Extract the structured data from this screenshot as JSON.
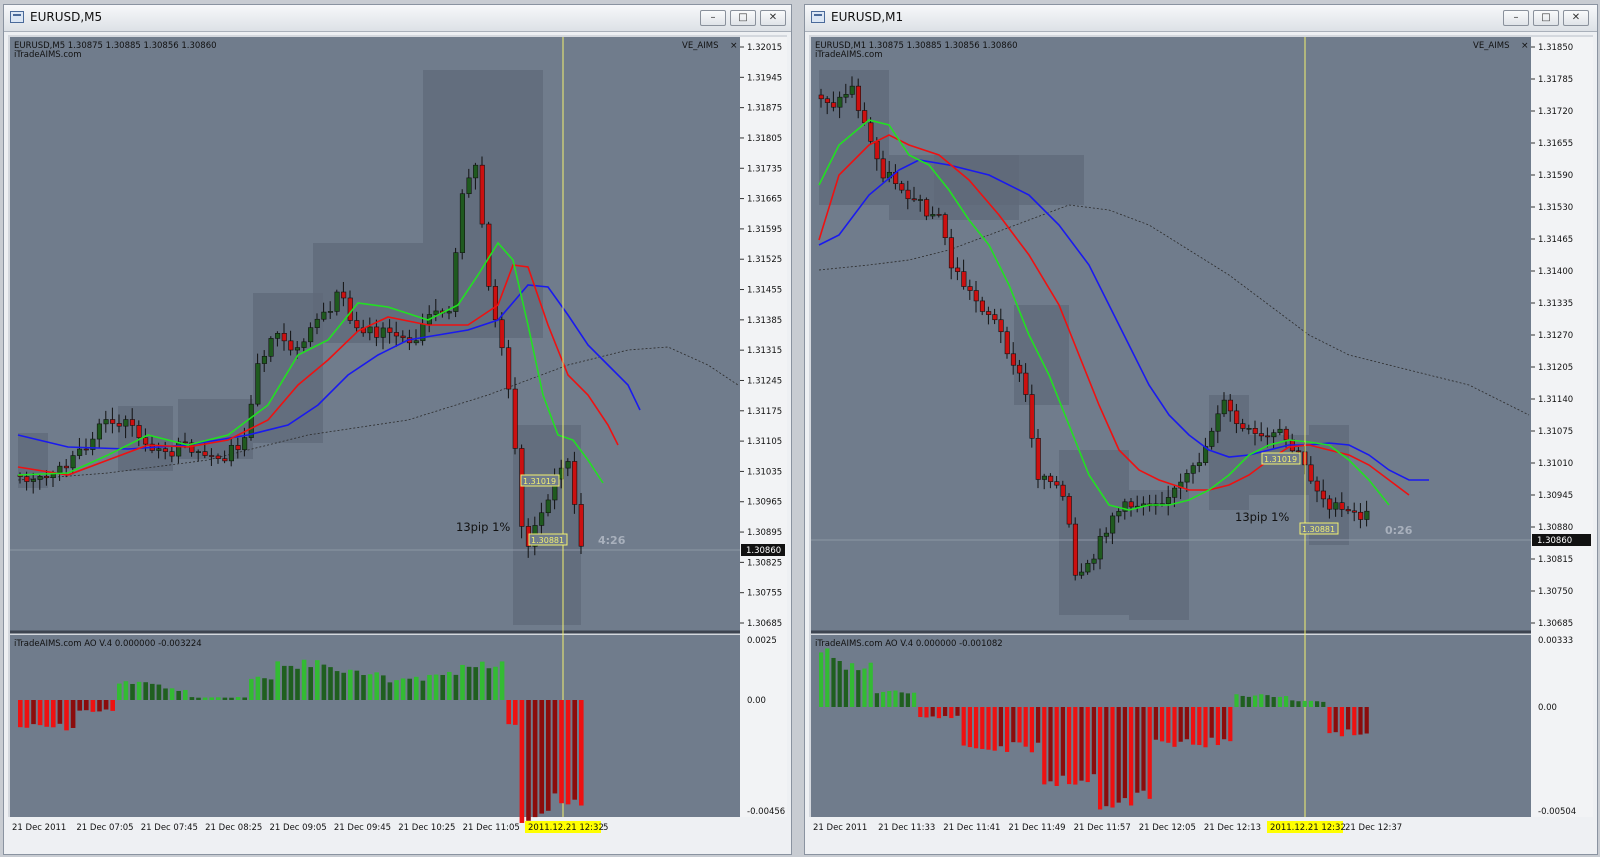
{
  "windows": [
    {
      "title": "EURUSD,M5",
      "ohlc": "EURUSD,M5  1.30875 1.30885 1.30856 1.30860",
      "site": "iTradeAIMS.com",
      "indicator": "VE_AIMS",
      "close_glyph": "×",
      "annotation": "13pip 1%",
      "timer": "4:26",
      "level_hi": "1.31019",
      "level_lo": "1.30881",
      "price_now": "1.30860",
      "price_ticks": [
        "1.32015",
        "1.31945",
        "1.31875",
        "1.31805",
        "1.31735",
        "1.31665",
        "1.31595",
        "1.31525",
        "1.31455",
        "1.31385",
        "1.31315",
        "1.31245",
        "1.31175",
        "1.31105",
        "1.31035",
        "1.30965",
        "1.30895",
        "1.30825",
        "1.30755",
        "1.30685"
      ],
      "sub_label": "iTradeAIMS.com AO V.4 0.000000 -0.003224",
      "sub_ticks": [
        "0.0025",
        "0.00",
        "-0.00456"
      ],
      "time_ticks": [
        "21 Dec 2011",
        "21 Dec 07:05",
        "21 Dec 07:45",
        "21 Dec 08:25",
        "21 Dec 09:05",
        "21 Dec 09:45",
        "21 Dec 10:25",
        "21 Dec 11:05",
        "21 Dec"
      ],
      "time_cursor": "2011.12.21 12:32",
      "time_cursor_suffix": "5"
    },
    {
      "title": "EURUSD,M1",
      "ohlc": "EURUSD,M1  1.30875 1.30885 1.30856 1.30860",
      "site": "iTradeAIMS.com",
      "indicator": "VE_AIMS",
      "close_glyph": "×",
      "annotation": "13pip 1%",
      "timer": "0:26",
      "level_hi": "1.31019",
      "level_lo": "1.30881",
      "price_now": "1.30860",
      "price_ticks": [
        "1.31850",
        "1.31785",
        "1.31720",
        "1.31655",
        "1.31590",
        "1.31530",
        "1.31465",
        "1.31400",
        "1.31335",
        "1.31270",
        "1.31205",
        "1.31140",
        "1.31075",
        "1.31010",
        "1.30945",
        "1.30880",
        "1.30815",
        "1.30750",
        "1.30685"
      ],
      "sub_label": "iTradeAIMS.com AO V.4 0.000000 -0.001082",
      "sub_ticks": [
        "0.00333",
        "0.00",
        "-0.00504"
      ],
      "time_ticks": [
        "21 Dec 2011",
        "21 Dec 11:33",
        "21 Dec 11:41",
        "21 Dec 11:49",
        "21 Dec 11:57",
        "21 Dec 12:05",
        "21 Dec 12:13",
        "21 Dec 12:2"
      ],
      "time_cursor": "2011.12.21 12:32",
      "time_cursor_suffix": "21 Dec 12:37"
    }
  ],
  "colors": {
    "chart_bg": "#707c8c",
    "bull": "#1f5a1f",
    "bear": "#cc1010",
    "ma_fast": "#22e022",
    "ma_mid": "#ee1111",
    "ma_slow": "#1a1aee",
    "cursor": "#f2f070",
    "ao_up": "#33bb33",
    "ao_up_dark": "#1f5f1f",
    "ao_dn": "#ee1111",
    "ao_dn_dark": "#8b0c0c"
  },
  "icons": [
    "chart-window-icon",
    "minimize-icon",
    "maximize-icon",
    "close-icon"
  ]
}
